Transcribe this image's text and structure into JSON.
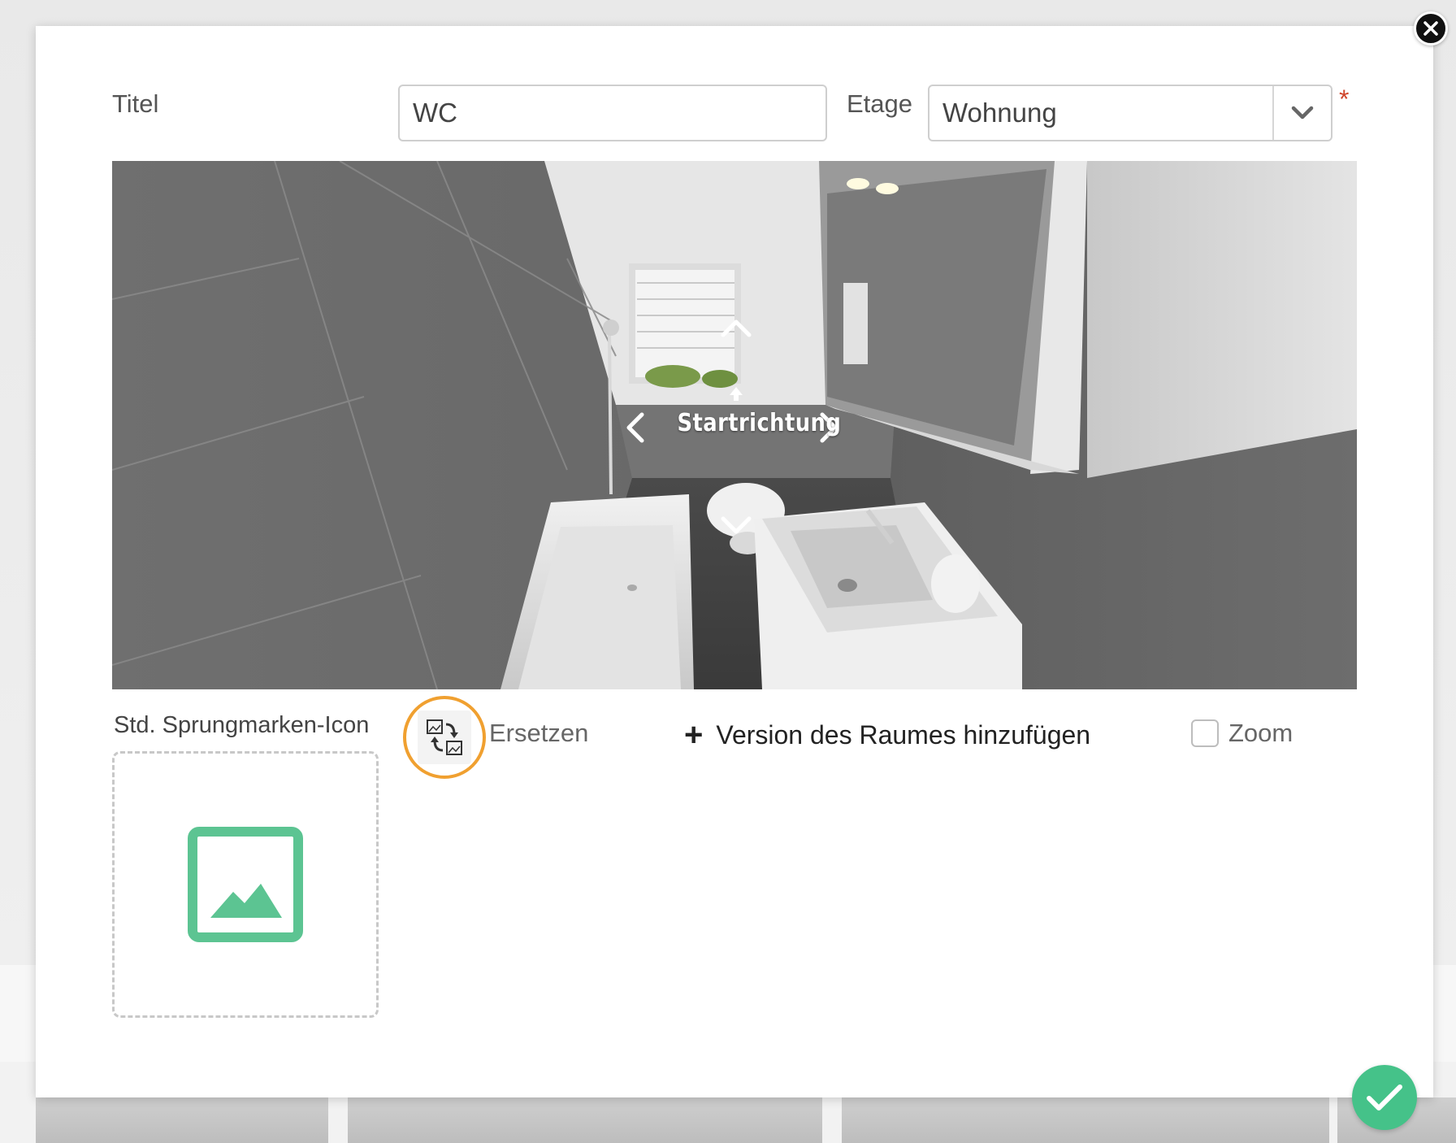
{
  "dialog": {
    "title_label": "Titel",
    "title_value": "WC",
    "floor_label": "Etage",
    "floor_value": "Wohnung",
    "required_marker": "*"
  },
  "panorama": {
    "direction_label": "Startrichtung"
  },
  "jump_marker": {
    "section_label": "Std. Sprungmarken-Icon",
    "replace_label": "Ersetzen",
    "image_placeholder_icon": "image-icon",
    "replace_icon": "swap-images-icon"
  },
  "actions": {
    "add_version_plus": "+",
    "add_version_label": "Version des Raumes hinzufügen",
    "zoom_label": "Zoom",
    "zoom_checked": false
  },
  "colors": {
    "accent_green": "#45c289",
    "placeholder_green": "#5cc492",
    "highlight_orange": "#f0a030",
    "required_red": "#d0452b"
  }
}
